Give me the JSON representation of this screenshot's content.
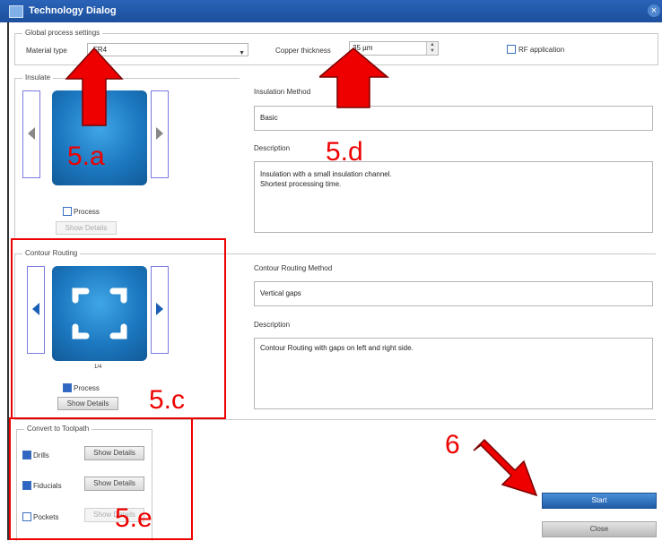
{
  "window": {
    "title": "Technology Dialog",
    "close_glyph": "×"
  },
  "global": {
    "legend": "Global process settings",
    "material_label": "Material type",
    "material_value": "FR4",
    "copper_label": "Copper thickness",
    "copper_value": "35 µm",
    "rf_label": "RF application",
    "rf_checked": false
  },
  "insulate": {
    "legend": "Insulate",
    "method_label": "Insulation Method",
    "method_value": "Basic",
    "description_label": "Description",
    "description_text": "Insulation with a small insulation channel.\nShortest processing time.",
    "process_label": "Process",
    "process_checked": false,
    "details_label": "Show Details"
  },
  "contour": {
    "legend": "Contour Routing",
    "counter": "1/4",
    "method_label": "Contour Routing Method",
    "method_value": "Vertical gaps",
    "description_label": "Description",
    "description_text": "Contour Routing with gaps on left and right side.",
    "process_label": "Process",
    "process_checked": true,
    "details_label": "Show Details"
  },
  "toolpath": {
    "legend": "Convert to Toolpath",
    "items": [
      {
        "label": "Drills",
        "checked": true,
        "details_label": "Show Details",
        "enabled": true
      },
      {
        "label": "Fiducials",
        "checked": true,
        "details_label": "Show Details",
        "enabled": true
      },
      {
        "label": "Pockets",
        "checked": false,
        "details_label": "Show Details",
        "enabled": false
      }
    ]
  },
  "actions": {
    "start_label": "Start",
    "close_label": "Close"
  },
  "annotations": {
    "a": "5.a",
    "c": "5.c",
    "d": "5.d",
    "e": "5.e",
    "six": "6",
    "arrow_color": "#ee0000"
  },
  "colors": {
    "titlebar": "#1d4f9c",
    "accent": "#2e66c2",
    "annotation": "#ee0000"
  }
}
